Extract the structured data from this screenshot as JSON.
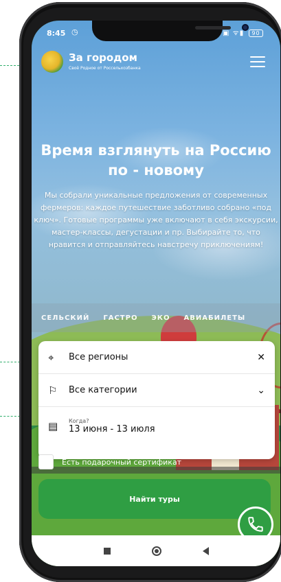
{
  "status": {
    "time": "8:45",
    "battery": "90"
  },
  "header": {
    "title": "За городом",
    "subtitle": "Своё Родное от Россельхозбанка"
  },
  "hero": {
    "title": "Время взглянуть на Россию по - новому",
    "text": "Мы собрали уникальные предложения от современных фермеров: каждое путешествие заботливо собрано «под ключ». Готовые программы уже включают в себя экскурсии, мастер-классы, дегустации и пр. Выбирайте то, что нравится и отправляйтесь навстречу приключениям!"
  },
  "tabs": [
    "СЕЛЬСКИЙ",
    "ГАСТРО",
    "ЭКО",
    "АВИАБИЛЕТЫ"
  ],
  "form": {
    "region": "Все регионы",
    "category": "Все категории",
    "when_label": "Когда?",
    "dates": "13 июня - 13 июля"
  },
  "gift_label": "Есть подарочный сертификат",
  "search_button": "Найти туры",
  "icons": {
    "location": "location-pin-icon",
    "flag": "flag-icon",
    "calendar": "calendar-icon",
    "close": "close-icon",
    "chevron": "chevron-down-icon",
    "phone": "phone-icon",
    "menu": "menu-icon"
  },
  "colors": {
    "accent": "#2f9e43"
  }
}
